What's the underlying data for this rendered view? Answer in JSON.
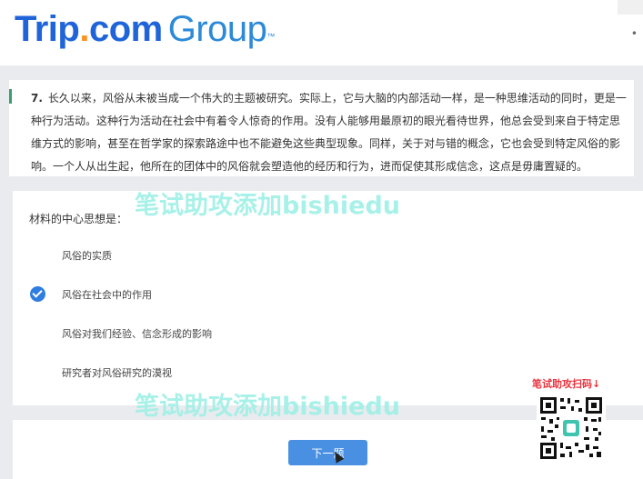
{
  "header": {
    "logo_brand": "Trip",
    "logo_dot": ".",
    "logo_com": "com",
    "logo_group": "Group",
    "logo_tm": "™"
  },
  "question": {
    "number": "7.",
    "text": "长久以来，风俗从未被当成一个伟大的主题被研究。实际上，它与大脑的内部活动一样，是一种思维活动的同时，更是一种行为活动。这种行为活动在社会中有着令人惊奇的作用。没有人能够用最原初的眼光看待世界，他总会受到来自于特定思维方式的影响，甚至在哲学家的探索路途中也不能避免这些典型现象。同样，关于对与错的概念，它也会受到特定风俗的影响。一个人从出生起，他所在的团体中的风俗就会塑造他的经历和行为，进而促使其形成信念，这点是毋庸置疑的。"
  },
  "prompt": "材料的中心思想是：",
  "options": [
    {
      "label": "风俗的实质",
      "selected": false
    },
    {
      "label": "风俗在社会中的作用",
      "selected": true
    },
    {
      "label": "风俗对我们经验、信念形成的影响",
      "selected": false
    },
    {
      "label": "研究者对风俗研究的漠视",
      "selected": false
    }
  ],
  "next_button": "下一题",
  "watermarks": [
    "笔试助攻添加bishiedu",
    "笔试助攻添加bishiedu"
  ],
  "qr_label": "笔试助攻扫码↓",
  "colors": {
    "brand_blue": "#1f64d8",
    "brand_orange": "#f7931e",
    "accent_green": "#3a9f6e",
    "button_blue": "#4a90e2",
    "watermark": "#9ff0e6",
    "qr_label_red": "#e8333d"
  }
}
